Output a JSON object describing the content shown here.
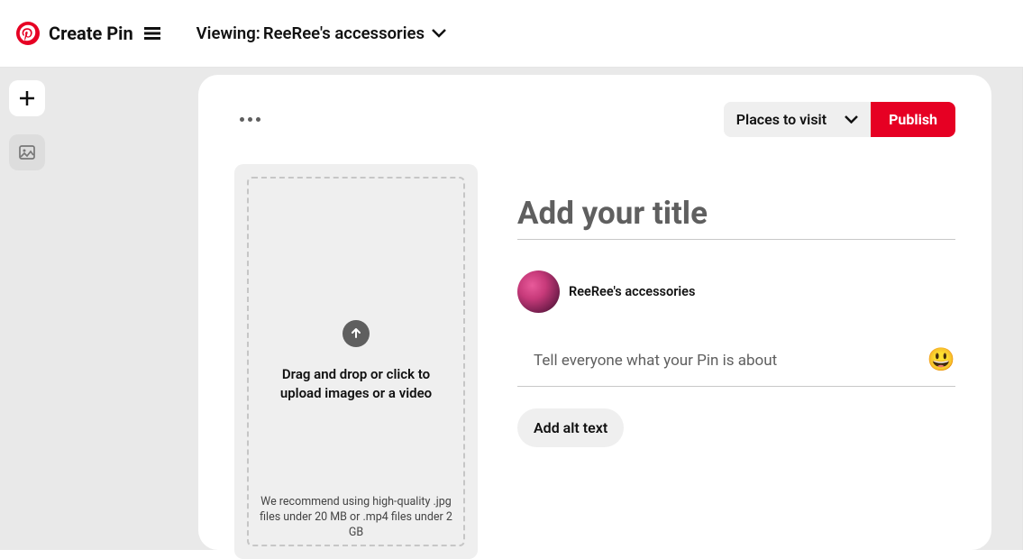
{
  "header": {
    "title": "Create Pin",
    "viewing_prefix": "Viewing: ",
    "viewing_board": "ReeRee's accessories"
  },
  "rail": {
    "add_label": "+",
    "thumb_label": "image"
  },
  "toolbar": {
    "board_selected": "Places to visit",
    "publish_label": "Publish"
  },
  "upload": {
    "main_text": "Drag and drop or click to upload images or a video",
    "hint": "We recommend using high-quality .jpg files under 20 MB or .mp4 files under 2 GB"
  },
  "form": {
    "title_placeholder": "Add your title",
    "author_name": "ReeRee's accessories",
    "description_placeholder": "Tell everyone what your Pin is about",
    "emoji": "😃",
    "alt_text_label": "Add alt text"
  }
}
